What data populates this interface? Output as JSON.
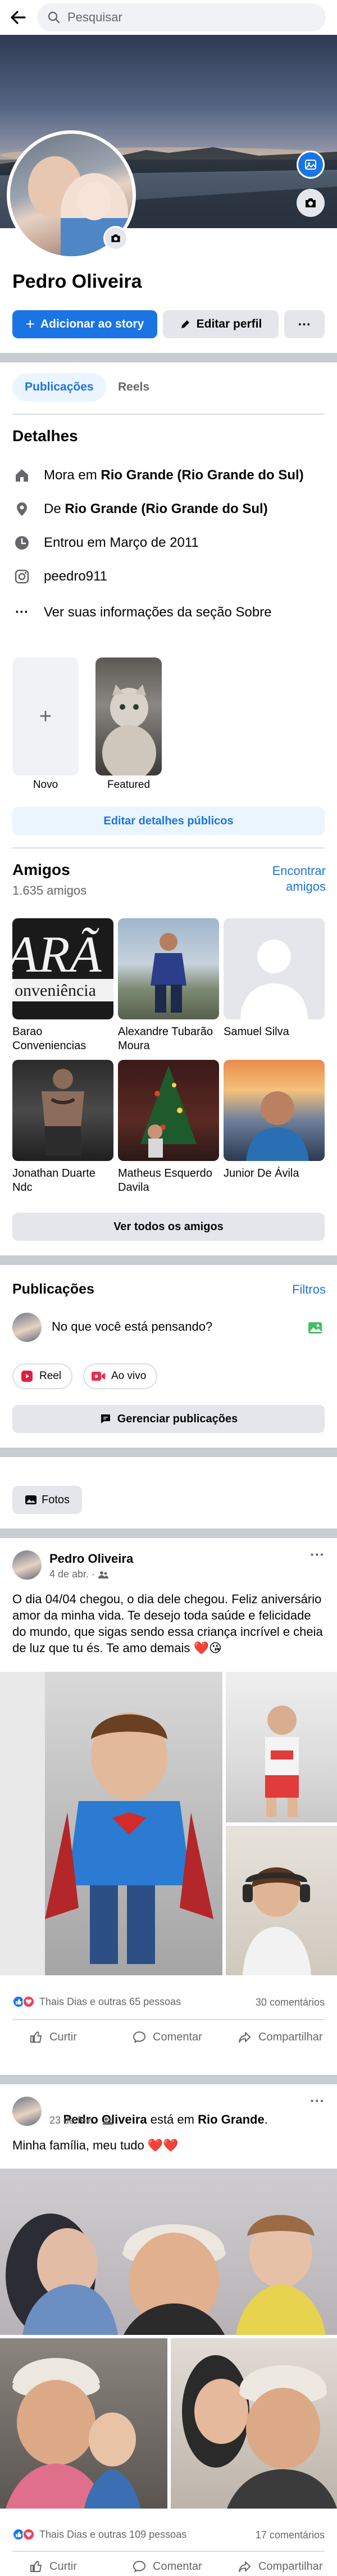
{
  "search": {
    "placeholder": "Pesquisar"
  },
  "profile": {
    "name": "Pedro Oliveira",
    "add_story_label": "Adicionar ao story",
    "edit_profile_label": "Editar perfil",
    "more_label": "..."
  },
  "tabs": [
    {
      "label": "Publicações",
      "active": true
    },
    {
      "label": "Reels",
      "active": false
    }
  ],
  "details": {
    "heading": "Detalhes",
    "lives_prefix": "Mora em ",
    "lives_city": "Rio Grande (Rio Grande do Sul)",
    "from_prefix": "De ",
    "from_city": "Rio Grande (Rio Grande do Sul)",
    "joined": "Entrou em Março de 2011",
    "instagram": "peedro911",
    "about_link": "Ver suas informações da seção Sobre"
  },
  "featured": {
    "new_label": "Novo",
    "featured_label": "Featured",
    "edit_button": "Editar detalhes públicos"
  },
  "friends": {
    "heading": "Amigos",
    "count": "1.635 amigos",
    "find_label": "Encontrar amigos",
    "list": [
      {
        "name": "Barao Conveniencias"
      },
      {
        "name": "Alexandre Tubarão Moura"
      },
      {
        "name": "Samuel Silva"
      },
      {
        "name": "Jonathan Duarte Ndc"
      },
      {
        "name": "Matheus Esquerdo Davila"
      },
      {
        "name": "Junior De Ávila"
      }
    ],
    "see_all_button": "Ver todos os amigos"
  },
  "publications": {
    "heading": "Publicações",
    "filters_label": "Filtros",
    "composer_placeholder": "No que você está pensando?",
    "reel_label": "Reel",
    "live_label": "Ao vivo",
    "manage_label": "Gerenciar publicações",
    "photos_label": "Fotos"
  },
  "posts": [
    {
      "author": "Pedro Oliveira",
      "date": "4 de abr. ·",
      "text": "O dia 04/04 chegou, o dia dele chegou. Feliz aniversário amor da minha vida. Te desejo toda saúde e felicidade do mundo, que sigas sendo essa criança incrível e cheia de luz que tu és. Te amo demais ❤️😘",
      "reactions": "Thais Dias e outras 65 pessoas",
      "comments": "30 comentários"
    },
    {
      "author": "Pedro Oliveira",
      "location_mid": " está em ",
      "location": "Rio Grande",
      "location_end": ".",
      "date": "23 de fev. ·",
      "text": "Minha família, meu tudo ❤️❤️",
      "reactions": "Thais Dias e outras 109 pessoas",
      "comments": "17 comentários"
    }
  ],
  "actions": {
    "like": "Curtir",
    "comment": "Comentar",
    "share": "Compartilhar"
  },
  "colors": {
    "accent": "#1b74e4",
    "separator": "#c9ccd1",
    "muted": "#65676b"
  }
}
